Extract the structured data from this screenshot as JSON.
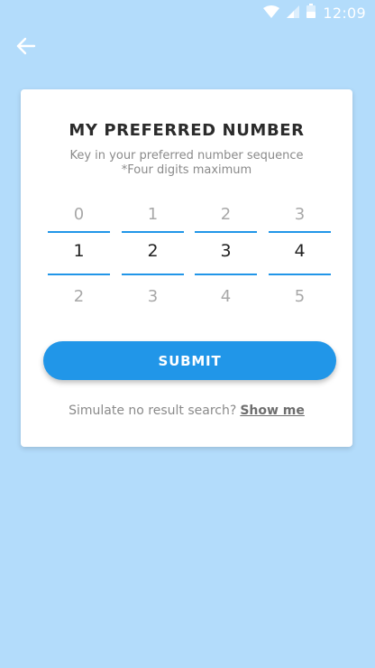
{
  "status_bar": {
    "time": "12:09",
    "icons": [
      "wifi-icon",
      "signal-icon",
      "battery-icon"
    ]
  },
  "header": {
    "back_icon": "arrow-left-icon"
  },
  "card": {
    "title": "MY PREFERRED NUMBER",
    "subtitle_line1": "Key in your preferred number sequence",
    "subtitle_line2": "*Four digits maximum",
    "picker": [
      {
        "prev": "0",
        "current": "1",
        "next": "2"
      },
      {
        "prev": "1",
        "current": "2",
        "next": "3"
      },
      {
        "prev": "2",
        "current": "3",
        "next": "4"
      },
      {
        "prev": "3",
        "current": "4",
        "next": "5"
      }
    ],
    "submit_label": "SUBMIT",
    "simulate_text": "Simulate no result search?",
    "show_me_label": "Show me"
  },
  "colors": {
    "background": "#b3dcfb",
    "accent": "#2196e8",
    "card": "#ffffff"
  }
}
